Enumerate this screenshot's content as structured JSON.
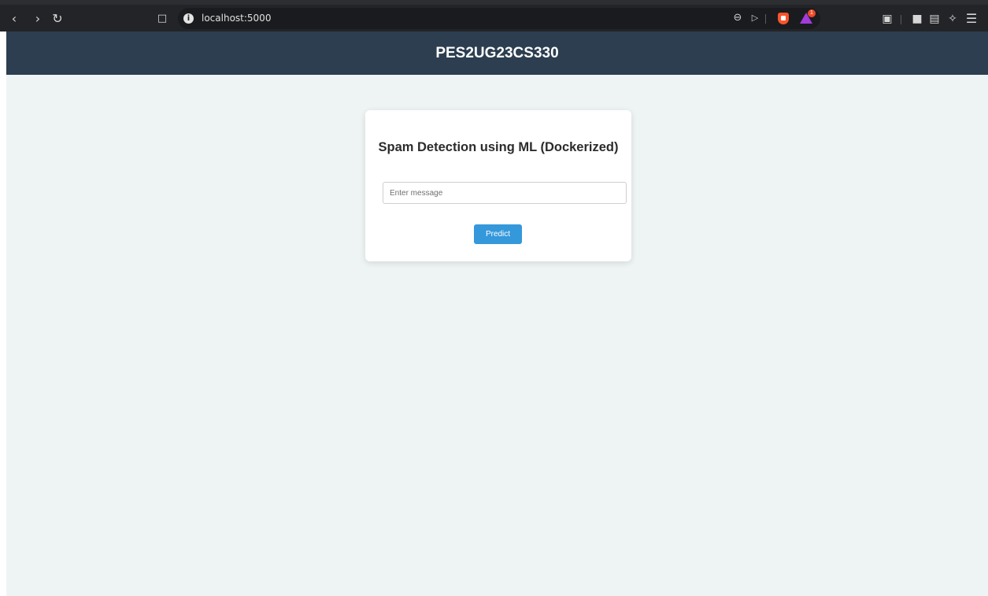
{
  "browser": {
    "url": "localhost:5000",
    "icons": {
      "back": "chevron-left-icon",
      "forward": "chevron-right-icon",
      "reload": "reload-icon",
      "bookmark": "bookmark-icon",
      "site_info": "info-icon",
      "zoom": "zoom-out-icon",
      "send": "send-icon",
      "shields": "brave-shields-icon",
      "rewards": "brave-rewards-icon",
      "screenshot": "screenshot-icon",
      "sidebar": "sidebar-icon",
      "wallet": "wallet-icon",
      "leo": "leo-ai-icon",
      "menu": "hamburger-menu-icon"
    },
    "rewards_badge": "1"
  },
  "header": {
    "title": "PES2UG23CS330"
  },
  "card": {
    "title": "Spam Detection using ML (Dockerized)",
    "input_placeholder": "Enter message",
    "input_value": "",
    "button_label": "Predict"
  },
  "colors": {
    "header_bg": "#2c3e50",
    "page_bg": "#eef4f4",
    "button_bg": "#3498db"
  }
}
